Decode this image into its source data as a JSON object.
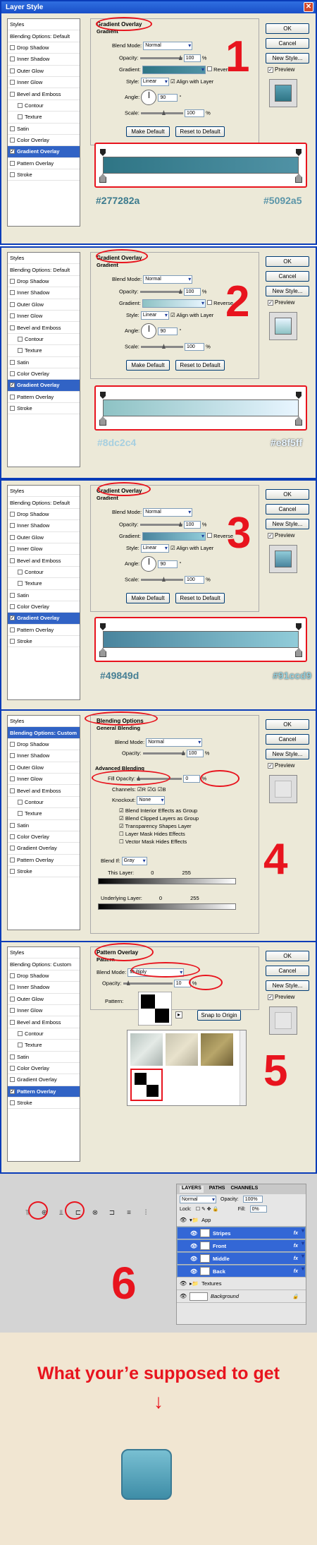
{
  "window_title": "Layer Style",
  "close_glyph": "✕",
  "buttons": {
    "ok": "OK",
    "cancel": "Cancel",
    "new_style": "New Style...",
    "preview": "Preview",
    "make_default": "Make Default",
    "reset_default": "Reset to Default",
    "snap_origin": "Snap to Origin"
  },
  "styles_list": [
    "Styles",
    "Blending Options: Default",
    "Drop Shadow",
    "Inner Shadow",
    "Outer Glow",
    "Inner Glow",
    "Bevel and Emboss",
    "Contour",
    "Texture",
    "Satin",
    "Color Overlay",
    "Gradient Overlay",
    "Pattern Overlay",
    "Stroke"
  ],
  "blend_custom": "Blending Options: Custom",
  "gradient_labels": {
    "title": "Gradient Overlay",
    "sub": "Gradient",
    "blend_mode": "Blend Mode:",
    "opacity": "Opacity:",
    "gradient": "Gradient:",
    "reverse": "Reverse",
    "style": "Style:",
    "align": "Align with Layer",
    "angle": "Angle:",
    "scale": "Scale:",
    "normal": "Normal",
    "linear": "Linear",
    "pct": "%"
  },
  "steps": [
    {
      "number": "1",
      "opacity": "100",
      "angle": "90",
      "scale": "100",
      "color_left": "#277282a",
      "color_right": "#5092a5",
      "grad_a": "#2f7585",
      "grad_b": "#5092a5"
    },
    {
      "number": "2",
      "opacity": "100",
      "angle": "90",
      "scale": "100",
      "color_left": "#8dc2c4",
      "color_right": "#e8f5ff",
      "grad_a": "#8dc2c4",
      "grad_b": "#e8f5ff"
    },
    {
      "number": "3",
      "opacity": "100",
      "angle": "90",
      "scale": "100",
      "color_left": "#49849d",
      "color_right": "#91ccd9",
      "grad_a": "#49849d",
      "grad_b": "#91ccd9"
    }
  ],
  "blending": {
    "number": "4",
    "title": "Blending Options",
    "sub": "General Blending",
    "blend_mode": "Blend Mode:",
    "mode": "Normal",
    "opacity": "Opacity:",
    "opacity_val": "100",
    "advanced": "Advanced Blending",
    "fill": "Fill Opacity:",
    "fill_val": "0",
    "channels": "Channels:",
    "r": "R",
    "g": "G",
    "b": "B",
    "knockout": "Knockout:",
    "knockout_val": "None",
    "checks": [
      "Blend Interior Effects as Group",
      "Blend Clipped Layers as Group",
      "Transparency Shapes Layer",
      "Layer Mask Hides Effects",
      "Vector Mask Hides Effects"
    ],
    "blend_if": "Blend If:",
    "blend_if_val": "Gray",
    "this_layer": "This Layer:",
    "underlying": "Underlying Layer:",
    "v0": "0",
    "v255": "255"
  },
  "pattern": {
    "number": "5",
    "title": "Pattern Overlay",
    "sub": "Pattern",
    "blend_mode": "Blend Mode:",
    "mode": "Multiply",
    "opacity": "Opacity:",
    "opacity_val": "10",
    "pattern": "Pattern:"
  },
  "section6": {
    "number": "6",
    "tabs": [
      "LAYERS",
      "PATHS",
      "CHANNELS"
    ],
    "blend_mode": "Normal",
    "opacity_label": "Opacity:",
    "opacity_val": "100%",
    "lock": "Lock:",
    "fill_label": "Fill:",
    "fill_val": "0%",
    "layers": [
      "App",
      "Stripes",
      "Front",
      "Middle",
      "Back",
      "Textures",
      "Background"
    ],
    "fx": "fx"
  },
  "final": {
    "headline": "What your’e supposed to get",
    "arrow": "↓"
  }
}
